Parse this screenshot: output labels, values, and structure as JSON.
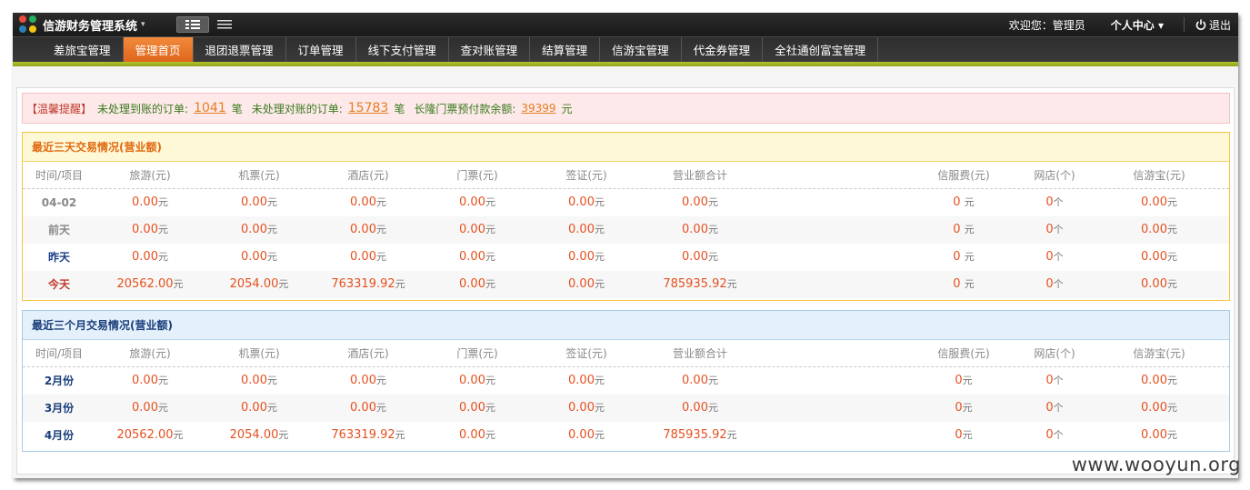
{
  "app": {
    "title": "信游财务管理系统",
    "caret": "▾",
    "welcome": "欢迎您：管理员",
    "user_center": "个人中心 ▾",
    "logout": "退出"
  },
  "nav": [
    {
      "label": "差旅宝管理",
      "active": false
    },
    {
      "label": "管理首页",
      "active": true
    },
    {
      "label": "退团退票管理",
      "active": false
    },
    {
      "label": "订单管理",
      "active": false
    },
    {
      "label": "线下支付管理",
      "active": false
    },
    {
      "label": "查对账管理",
      "active": false
    },
    {
      "label": "结算管理",
      "active": false
    },
    {
      "label": "信游宝管理",
      "active": false
    },
    {
      "label": "代金券管理",
      "active": false
    },
    {
      "label": "全社通创富宝管理",
      "active": false
    }
  ],
  "alert": {
    "label": "【温馨提醒】",
    "unprocessed_orders_text": "未处理到账的订单:",
    "unprocessed_orders_value": "1041",
    "unit1": "笔",
    "unreconciled_text": "未处理对账的订单:",
    "unreconciled_value": "15783",
    "unit2": "笔",
    "prepaid_text": "长隆门票预付款余额:",
    "prepaid_value": "39399",
    "unit3": "元"
  },
  "columns": [
    "时间/项目",
    "旅游(元)",
    "机票(元)",
    "酒店(元)",
    "门票(元)",
    "签证(元)",
    "营业额合计",
    "信服费(元)",
    "网店(个)",
    "信游宝(元)"
  ],
  "three_days": {
    "title": "最近三天交易情况(营业额)",
    "rows": [
      {
        "label": "04-02",
        "cells": [
          "0.00",
          "0.00",
          "0.00",
          "0.00",
          "0.00",
          "0.00",
          "0 ",
          "0",
          "0.00"
        ]
      },
      {
        "label": "前天",
        "cells": [
          "0.00",
          "0.00",
          "0.00",
          "0.00",
          "0.00",
          "0.00",
          "0 ",
          "0",
          "0.00"
        ]
      },
      {
        "label": "昨天",
        "cells": [
          "0.00",
          "0.00",
          "0.00",
          "0.00",
          "0.00",
          "0.00",
          "0 ",
          "0",
          "0.00"
        ]
      },
      {
        "label": "今天",
        "cells": [
          "20562.00",
          "2054.00",
          "763319.92",
          "0.00",
          "0.00",
          "785935.92",
          "0 ",
          "0",
          "0.00"
        ]
      }
    ]
  },
  "three_months": {
    "title": "最近三个月交易情况(营业额)",
    "rows": [
      {
        "label": "2月份",
        "cells": [
          "0.00",
          "0.00",
          "0.00",
          "0.00",
          "0.00",
          "0.00",
          "0",
          "0",
          "0.00"
        ]
      },
      {
        "label": "3月份",
        "cells": [
          "0.00",
          "0.00",
          "0.00",
          "0.00",
          "0.00",
          "0.00",
          "0",
          "0",
          "0.00"
        ]
      },
      {
        "label": "4月份",
        "cells": [
          "20562.00",
          "2054.00",
          "763319.92",
          "0.00",
          "0.00",
          "785935.92",
          "0",
          "0",
          "0.00"
        ]
      }
    ]
  },
  "units": {
    "yuan": "元",
    "ge": "个"
  },
  "colors": {
    "accent_orange": "#e0651c",
    "value_red": "#e5501f",
    "nav_green": "#8fa11b"
  },
  "watermark": "www.wooyun.org"
}
